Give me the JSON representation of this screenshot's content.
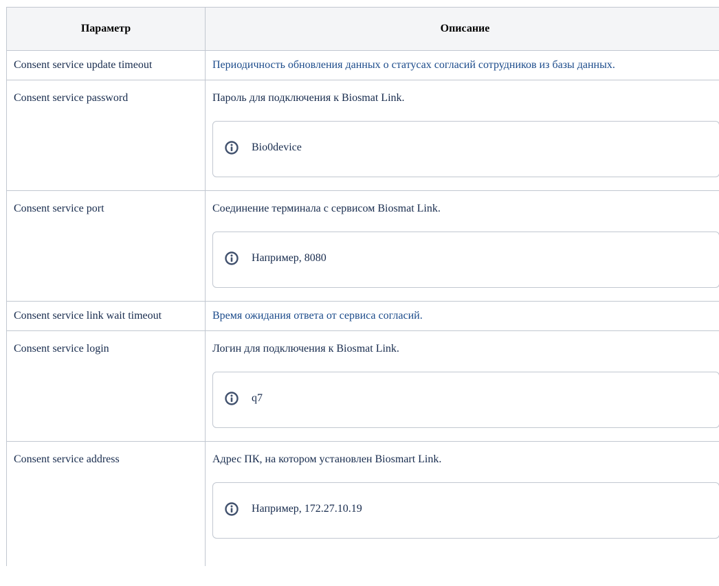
{
  "table": {
    "headers": {
      "param": "Параметр",
      "description": "Описание"
    },
    "rows": [
      {
        "param": "Consent service update timeout",
        "description": "Периодичность обновления данных о статусах согласий сотрудников из базы данных."
      },
      {
        "param": "Consent service password",
        "description": "Пароль для подключения к Biosmat Link.",
        "info": "Bio0device"
      },
      {
        "param": "Consent service port",
        "description": "Соединение терминала с сервисом Biosmat Link.",
        "info": "Например, 8080"
      },
      {
        "param": "Consent service link wait timeout",
        "description": "Время ожидания ответа от сервиса согласий."
      },
      {
        "param": "Consent service login",
        "description": "Логин для подключения к Biosmat Link.",
        "info": "q7"
      },
      {
        "param": "Consent service address",
        "description": "Адрес ПК, на котором установлен Biosmart Link.",
        "info": "Например, 172.27.10.19"
      }
    ]
  },
  "icons": {
    "info": "info-circle-icon"
  },
  "colors": {
    "border": "#c1c7d0",
    "header_bg": "#f4f5f7",
    "link_text": "#1a4a8a",
    "icon": "#42526e"
  }
}
